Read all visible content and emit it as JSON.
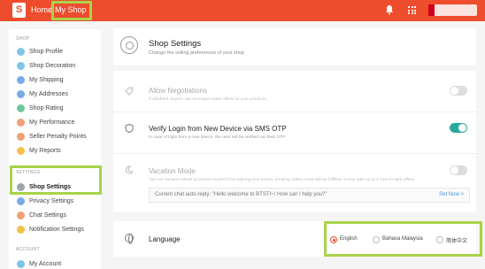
{
  "topbar": {
    "logo_glyph": "S",
    "home_label": "Home",
    "separator": "|",
    "myshop_label": "My Shop",
    "icons": [
      "bell-icon",
      "apps-grid-icon"
    ]
  },
  "sidebar": {
    "shop_heading": "SHOP",
    "shop_items": [
      {
        "label": "Shop Profile",
        "color": "#7fc4e6"
      },
      {
        "label": "Shop Decoration",
        "color": "#7fc4e6"
      },
      {
        "label": "My Shipping",
        "color": "#7aa9e8"
      },
      {
        "label": "My Addresses",
        "color": "#7aa9e8"
      },
      {
        "label": "Shop Rating",
        "color": "#72c59a"
      },
      {
        "label": "My Performance",
        "color": "#f0a078"
      },
      {
        "label": "Seller Penalty Points",
        "color": "#f0a078"
      },
      {
        "label": "My Reports",
        "color": "#f5c04a"
      }
    ],
    "settings_heading": "SETTINGS",
    "settings_items": [
      {
        "label": "Shop Settings",
        "color": "#9aa6b0"
      },
      {
        "label": "Privacy Settings",
        "color": "#7aa9e8"
      },
      {
        "label": "Chat Settings",
        "color": "#f0a078"
      },
      {
        "label": "Notification Settings",
        "color": "#f5c04a"
      }
    ],
    "account_heading": "ACCOUNT",
    "account_items": [
      {
        "label": "My Account",
        "color": "#7fc4e6"
      }
    ]
  },
  "main": {
    "title": "Shop Settings",
    "subtitle": "Change the selling preferences of your shop",
    "negotiations": {
      "title": "Allow Negotiations",
      "desc": "If disabled, buyers can no longer make offers on your products.",
      "enabled": false
    },
    "sms_otp": {
      "title": "Verify Login from New Device via SMS OTP",
      "desc": "In case of login from a new device, the user will be verified via SMS OTP.",
      "enabled": true
    },
    "vacation": {
      "title": "Vacation Mode",
      "desc": "Turn on Vacation Mode to prevent buyers from placing new orders. Existing orders must still be fulfilled. It may take up to 1 hour to take effect.",
      "enabled": false,
      "autoreply_text": "Current chat auto-reply: \"Hello welcome to BTSTI~! How can I help you?\"",
      "set_now_label": "Set Now >"
    },
    "language": {
      "label": "Language",
      "options": [
        "English",
        "Bahasa Malaysia",
        "简体中文"
      ],
      "selected": "English"
    }
  },
  "colors": {
    "brand": "#ee4d2d",
    "toggle_on": "#26aa99",
    "highlight": "#a9d24a"
  }
}
